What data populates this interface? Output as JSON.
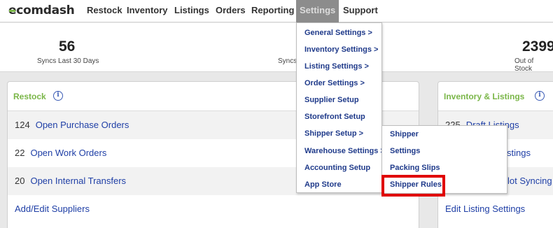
{
  "nav": {
    "logo": "ecomdash",
    "items": [
      "Restock",
      "Inventory",
      "Listings",
      "Orders",
      "Reporting",
      "Settings",
      "Support"
    ],
    "active": "Settings"
  },
  "stats": [
    {
      "value": "56",
      "label": "Syncs Last 30 Days"
    },
    {
      "value": "",
      "label": "Syncs"
    },
    {
      "value": "2399",
      "label": "Out of Stock"
    }
  ],
  "restock_panel": {
    "title": "Restock",
    "rows": [
      {
        "count": "124",
        "label": "Open Purchase Orders"
      },
      {
        "count": "22",
        "label": "Open Work Orders"
      },
      {
        "count": "20",
        "label": "Open Internal Transfers"
      },
      {
        "count": "",
        "label": "Add/Edit Suppliers"
      }
    ]
  },
  "inventory_panel": {
    "title": "Inventory & Listings",
    "rows": [
      {
        "count": "225",
        "label": "Draft Listings"
      },
      {
        "count": "",
        "label": "stings"
      },
      {
        "count": "",
        "label": "lot Syncing"
      },
      {
        "count": "",
        "label": "Edit Listing Settings"
      }
    ]
  },
  "settings_menu": {
    "items": [
      "General Settings >",
      "Inventory Settings >",
      "Listing Settings >",
      "Order Settings >",
      "Supplier Setup",
      "Storefront Setup",
      "Shipper Setup >",
      "Warehouse Settings >",
      "Accounting Setup",
      "App Store"
    ]
  },
  "shipper_submenu": {
    "items": [
      "Shipper",
      "Settings",
      "Packing Slips",
      "Shipper Rules"
    ],
    "highlighted": "Shipper Rules"
  },
  "icons": {
    "info": "info-icon"
  },
  "colors": {
    "accent_green": "#7ab648",
    "link_blue": "#1f3fa6",
    "highlight_red": "#e00000"
  }
}
